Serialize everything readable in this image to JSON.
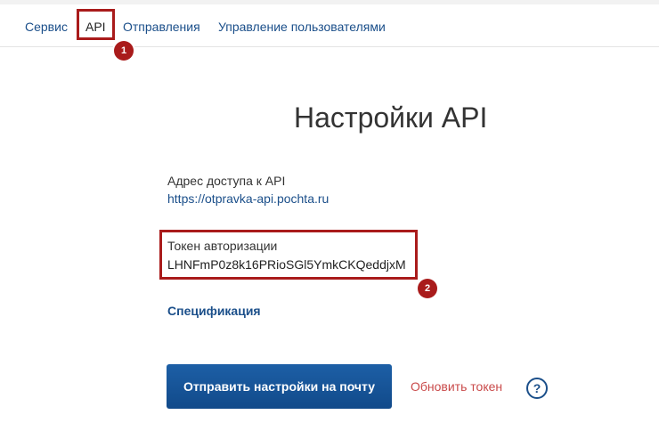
{
  "nav": {
    "tabs": [
      {
        "label": "Сервис"
      },
      {
        "label": "API"
      },
      {
        "label": "Отправления"
      },
      {
        "label": "Управление пользователями"
      }
    ],
    "active_tab": "API"
  },
  "annotations": {
    "marker_1": "1",
    "marker_2": "2"
  },
  "page": {
    "title": "Настройки API",
    "api_address": {
      "label": "Адрес доступа к API",
      "value": "https://otpravka-api.pochta.ru"
    },
    "token": {
      "label": "Токен авторизации",
      "value": "LHNFmP0z8k16PRioSGl5YmkCKQeddjxM"
    },
    "spec_link": "Спецификация",
    "send_button": "Отправить настройки на почту",
    "refresh_link": "Обновить токен",
    "help_icon": "?"
  },
  "colors": {
    "link_blue": "#1b4f8a",
    "button_blue": "#1d5fa6",
    "highlight_red": "#a91b1b",
    "refresh_red": "#c94a4a"
  },
  "icons": {
    "help": "question-circle-icon"
  }
}
